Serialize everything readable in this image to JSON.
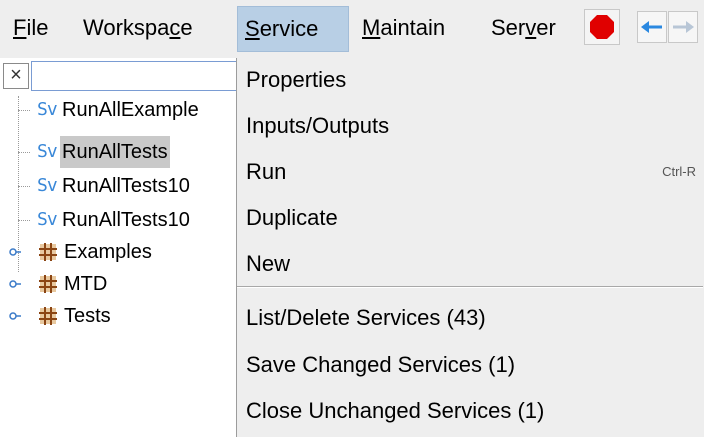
{
  "menubar": {
    "items": [
      {
        "label": "File",
        "mnemonic": "F"
      },
      {
        "label": "Workspace",
        "mnemonic": "c"
      },
      {
        "label": "Service",
        "mnemonic": "S"
      },
      {
        "label": "Maintain",
        "mnemonic": "M"
      },
      {
        "label": "Server",
        "mnemonic": "v"
      }
    ],
    "active": "Service",
    "stop_icon": "stop-octagon-icon",
    "back_icon": "arrow-left-icon",
    "forward_icon": "arrow-right-icon",
    "colors": {
      "active_bg": "#b8cfe5",
      "stop": "#e00000",
      "nav_arrow": "#2a88e0"
    }
  },
  "search": {
    "clear_label": "×",
    "value": ""
  },
  "tree": {
    "services": [
      {
        "label": "RunAllExample",
        "icon": "Sv"
      },
      {
        "label": "RunAllTests",
        "icon": "Sv",
        "selected": true
      },
      {
        "label": "RunAllTests10",
        "icon": "Sv"
      },
      {
        "label": "RunAllTests10",
        "icon": "Sv"
      }
    ],
    "folders": [
      {
        "label": "Examples"
      },
      {
        "label": "MTD"
      },
      {
        "label": "Tests"
      }
    ]
  },
  "service_menu": {
    "items": [
      {
        "label": "Properties",
        "shortcut": ""
      },
      {
        "label": "Inputs/Outputs",
        "shortcut": ""
      },
      {
        "label": "Run",
        "shortcut": "Ctrl-R"
      },
      {
        "label": "Duplicate",
        "shortcut": ""
      },
      {
        "label": "New",
        "shortcut": ""
      }
    ],
    "items2": [
      {
        "label": "List/Delete Services (43)"
      },
      {
        "label": "Save Changed Services (1)"
      },
      {
        "label": "Close Unchanged Services (1)"
      }
    ]
  }
}
